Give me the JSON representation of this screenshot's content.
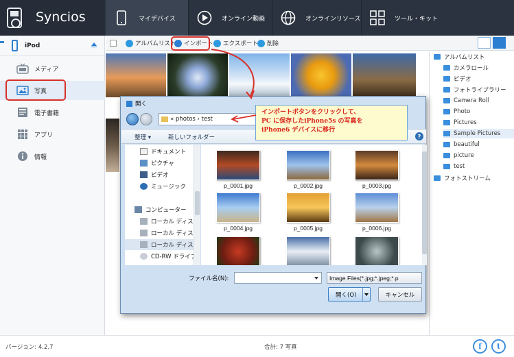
{
  "app": {
    "title": "Syncios"
  },
  "nav": {
    "items": [
      {
        "label": "マイデバイス",
        "icon": "phone-icon"
      },
      {
        "label": "オンライン動画",
        "icon": "play-icon"
      },
      {
        "label": "オンラインリソース",
        "icon": "globe-icon"
      },
      {
        "label": "ツール・キット",
        "icon": "grid-icon"
      }
    ]
  },
  "sidebar": {
    "device": "iPod",
    "items": [
      {
        "label": "メディア",
        "icon": "tv-icon"
      },
      {
        "label": "写真",
        "icon": "photo-icon"
      },
      {
        "label": "電子書籍",
        "icon": "book-icon"
      },
      {
        "label": "アプリ",
        "icon": "apps-icon"
      },
      {
        "label": "情報",
        "icon": "info-icon"
      }
    ]
  },
  "toolbar": {
    "album_list": "アルバムリスト",
    "import": "インポート",
    "export": "エクスポート",
    "delete": "削除"
  },
  "albums": {
    "items": [
      "アルバムリスト",
      "カメラロール",
      "ビデオ",
      "フォトライブラリー",
      "Camera Roll",
      "Photo",
      "Pictures",
      "Sample Pictures",
      "beautiful",
      "picture",
      "test",
      "フォトストリーム"
    ]
  },
  "dialog": {
    "title": "開く",
    "path_prefix": "«",
    "path_1": "photos",
    "path_sep": "›",
    "path_2": "test",
    "organize": "整理 ▾",
    "new_folder": "新しいフォルダー",
    "help": "?",
    "tree": [
      "ドキュメント",
      "ピクチャ",
      "ビデオ",
      "ミュージック",
      "コンピューター",
      "ローカル ディス",
      "ローカル ディス",
      "ローカル ディス",
      "CD-RW ドライブ"
    ],
    "files": [
      "p_0001.jpg",
      "p_0002.jpg",
      "p_0003.jpg",
      "p_0004.jpg",
      "p_0005.jpg",
      "p_0006.jpg",
      "",
      "",
      ""
    ],
    "filename_label": "ファイル名(N):",
    "filename_value": "",
    "filter": "Image Files(*.jpg;*.jpeg;*.p",
    "open": "開く(O)",
    "cancel": "キャンセル"
  },
  "note": {
    "line1": "インポートボタンをクリックして、",
    "line2": "PC に保存したiPhone5s の写真を",
    "line3": "iPhone6 デバイスに移行"
  },
  "status": {
    "version": "バージョン: 4.2.7",
    "total": "合計: 7 写真"
  },
  "social": {
    "facebook": "f",
    "twitter": "t"
  },
  "colors": {
    "topbar": "#2b3340",
    "accent": "#2d7fd1",
    "highlight": "#d9302a",
    "note_bg": "#fefbcf",
    "note_text": "#d8271d"
  }
}
